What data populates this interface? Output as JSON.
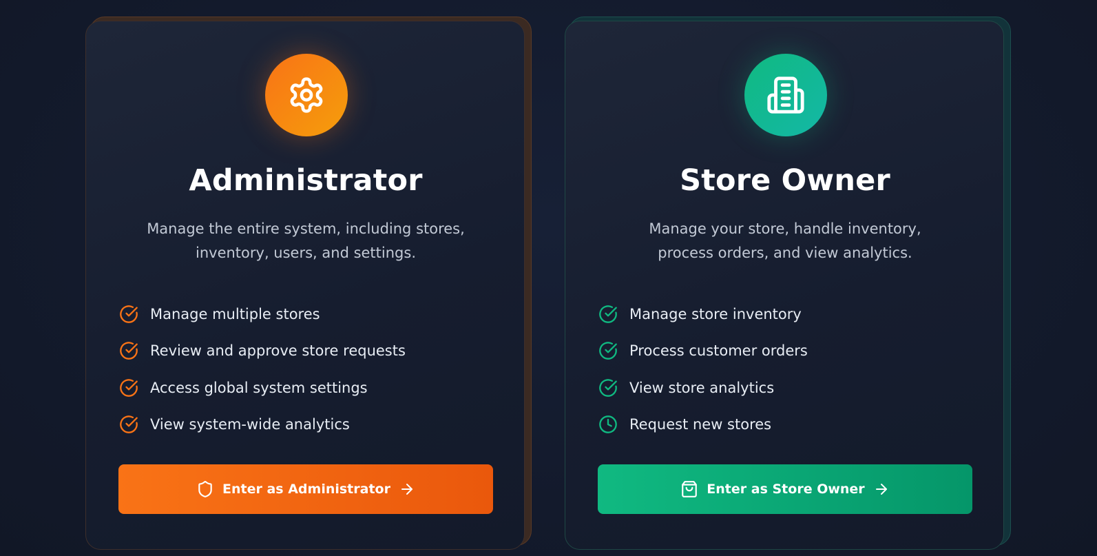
{
  "cards": [
    {
      "id": "admin",
      "icon": "gear-icon",
      "accent": "#f97316",
      "title": "Administrator",
      "description": "Manage the entire system, including stores, inventory, users, and settings.",
      "features": [
        {
          "icon": "check-circle-icon",
          "label": "Manage multiple stores"
        },
        {
          "icon": "check-circle-icon",
          "label": "Review and approve store requests"
        },
        {
          "icon": "check-circle-icon",
          "label": "Access global system settings"
        },
        {
          "icon": "check-circle-icon",
          "label": "View system-wide analytics"
        }
      ],
      "button": {
        "icon": "shield-icon",
        "label": "Enter as Administrator",
        "trailing_icon": "arrow-right-icon"
      }
    },
    {
      "id": "owner",
      "icon": "building-icon",
      "accent": "#10b981",
      "title": "Store Owner",
      "description": "Manage your store, handle inventory, process orders, and view analytics.",
      "features": [
        {
          "icon": "check-circle-icon",
          "label": "Manage store inventory"
        },
        {
          "icon": "check-circle-icon",
          "label": "Process customer orders"
        },
        {
          "icon": "check-circle-icon",
          "label": "View store analytics"
        },
        {
          "icon": "clock-icon",
          "label": "Request new stores"
        }
      ],
      "button": {
        "icon": "shopping-bag-icon",
        "label": "Enter as Store Owner",
        "trailing_icon": "arrow-right-icon"
      }
    }
  ]
}
